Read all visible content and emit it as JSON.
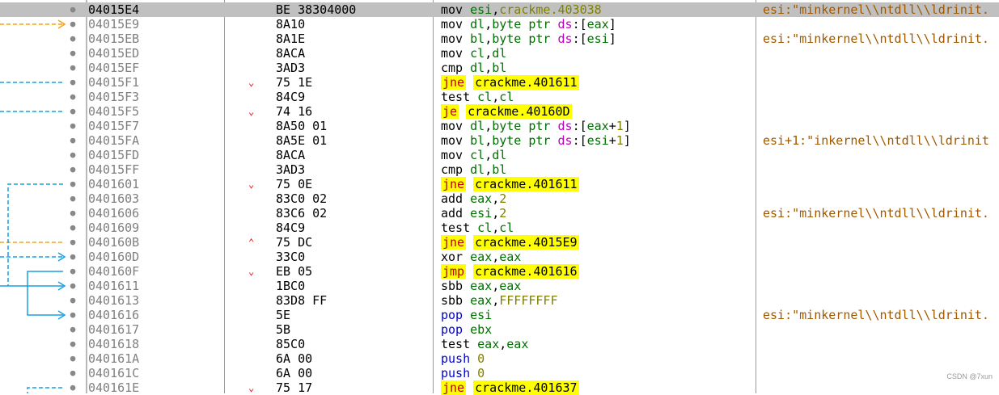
{
  "rows": [
    {
      "addr": "04015E4",
      "jmp": "",
      "bytes": "BE 38304000",
      "tokens": [
        {
          "t": "mov ",
          "c": "mn"
        },
        {
          "t": "esi",
          "c": "reg"
        },
        {
          "t": ",",
          "c": "mn"
        },
        {
          "t": "crackme.403038",
          "c": "num"
        }
      ],
      "comment": "esi:\"minkernel\\\\ntdll\\\\ldrinit.",
      "selected": true
    },
    {
      "addr": "04015E9",
      "jmp": "",
      "bytes": "8A10",
      "tokens": [
        {
          "t": "mov ",
          "c": "mn"
        },
        {
          "t": "dl",
          "c": "reg"
        },
        {
          "t": ",",
          "c": "mn"
        },
        {
          "t": "byte ptr ",
          "c": "op"
        },
        {
          "t": "ds",
          "c": "seg"
        },
        {
          "t": ":[",
          "c": "mn"
        },
        {
          "t": "eax",
          "c": "reg"
        },
        {
          "t": "]",
          "c": "mn"
        }
      ],
      "comment": ""
    },
    {
      "addr": "04015EB",
      "jmp": "",
      "bytes": "8A1E",
      "tokens": [
        {
          "t": "mov ",
          "c": "mn"
        },
        {
          "t": "bl",
          "c": "reg"
        },
        {
          "t": ",",
          "c": "mn"
        },
        {
          "t": "byte ptr ",
          "c": "op"
        },
        {
          "t": "ds",
          "c": "seg"
        },
        {
          "t": ":[",
          "c": "mn"
        },
        {
          "t": "esi",
          "c": "reg"
        },
        {
          "t": "]",
          "c": "mn"
        }
      ],
      "comment": "esi:\"minkernel\\\\ntdll\\\\ldrinit."
    },
    {
      "addr": "04015ED",
      "jmp": "",
      "bytes": "8ACA",
      "tokens": [
        {
          "t": "mov ",
          "c": "mn"
        },
        {
          "t": "cl",
          "c": "reg"
        },
        {
          "t": ",",
          "c": "mn"
        },
        {
          "t": "dl",
          "c": "reg"
        }
      ],
      "comment": ""
    },
    {
      "addr": "04015EF",
      "jmp": "",
      "bytes": "3AD3",
      "tokens": [
        {
          "t": "cmp ",
          "c": "mn"
        },
        {
          "t": "dl",
          "c": "reg"
        },
        {
          "t": ",",
          "c": "mn"
        },
        {
          "t": "bl",
          "c": "reg"
        }
      ],
      "comment": ""
    },
    {
      "addr": "04015F1",
      "jmp": "down",
      "bytes": "75 1E",
      "tokens": [
        {
          "t": "jne",
          "c": "jhl"
        },
        {
          "t": " ",
          "c": "mn"
        },
        {
          "t": "crackme.401611",
          "c": "thl"
        }
      ],
      "comment": ""
    },
    {
      "addr": "04015F3",
      "jmp": "",
      "bytes": "84C9",
      "tokens": [
        {
          "t": "test ",
          "c": "mn"
        },
        {
          "t": "cl",
          "c": "reg"
        },
        {
          "t": ",",
          "c": "mn"
        },
        {
          "t": "cl",
          "c": "reg"
        }
      ],
      "comment": ""
    },
    {
      "addr": "04015F5",
      "jmp": "down",
      "bytes": "74 16",
      "tokens": [
        {
          "t": "je",
          "c": "jhl"
        },
        {
          "t": " ",
          "c": "mn"
        },
        {
          "t": "crackme.40160D",
          "c": "thl"
        }
      ],
      "comment": ""
    },
    {
      "addr": "04015F7",
      "jmp": "",
      "bytes": "8A50 01",
      "tokens": [
        {
          "t": "mov ",
          "c": "mn"
        },
        {
          "t": "dl",
          "c": "reg"
        },
        {
          "t": ",",
          "c": "mn"
        },
        {
          "t": "byte ptr ",
          "c": "op"
        },
        {
          "t": "ds",
          "c": "seg"
        },
        {
          "t": ":[",
          "c": "mn"
        },
        {
          "t": "eax",
          "c": "reg"
        },
        {
          "t": "+",
          "c": "mn"
        },
        {
          "t": "1",
          "c": "num"
        },
        {
          "t": "]",
          "c": "mn"
        }
      ],
      "comment": ""
    },
    {
      "addr": "04015FA",
      "jmp": "",
      "bytes": "8A5E 01",
      "tokens": [
        {
          "t": "mov ",
          "c": "mn"
        },
        {
          "t": "bl",
          "c": "reg"
        },
        {
          "t": ",",
          "c": "mn"
        },
        {
          "t": "byte ptr ",
          "c": "op"
        },
        {
          "t": "ds",
          "c": "seg"
        },
        {
          "t": ":[",
          "c": "mn"
        },
        {
          "t": "esi",
          "c": "reg"
        },
        {
          "t": "+",
          "c": "mn"
        },
        {
          "t": "1",
          "c": "num"
        },
        {
          "t": "]",
          "c": "mn"
        }
      ],
      "comment": "esi+1:\"inkernel\\\\ntdll\\\\ldrinit"
    },
    {
      "addr": "04015FD",
      "jmp": "",
      "bytes": "8ACA",
      "tokens": [
        {
          "t": "mov ",
          "c": "mn"
        },
        {
          "t": "cl",
          "c": "reg"
        },
        {
          "t": ",",
          "c": "mn"
        },
        {
          "t": "dl",
          "c": "reg"
        }
      ],
      "comment": ""
    },
    {
      "addr": "04015FF",
      "jmp": "",
      "bytes": "3AD3",
      "tokens": [
        {
          "t": "cmp ",
          "c": "mn"
        },
        {
          "t": "dl",
          "c": "reg"
        },
        {
          "t": ",",
          "c": "mn"
        },
        {
          "t": "bl",
          "c": "reg"
        }
      ],
      "comment": ""
    },
    {
      "addr": "0401601",
      "jmp": "down",
      "bytes": "75 0E",
      "tokens": [
        {
          "t": "jne",
          "c": "jhl"
        },
        {
          "t": " ",
          "c": "mn"
        },
        {
          "t": "crackme.401611",
          "c": "thl"
        }
      ],
      "comment": ""
    },
    {
      "addr": "0401603",
      "jmp": "",
      "bytes": "83C0 02",
      "tokens": [
        {
          "t": "add ",
          "c": "mn"
        },
        {
          "t": "eax",
          "c": "reg"
        },
        {
          "t": ",",
          "c": "mn"
        },
        {
          "t": "2",
          "c": "num"
        }
      ],
      "comment": ""
    },
    {
      "addr": "0401606",
      "jmp": "",
      "bytes": "83C6 02",
      "tokens": [
        {
          "t": "add ",
          "c": "mn"
        },
        {
          "t": "esi",
          "c": "reg"
        },
        {
          "t": ",",
          "c": "mn"
        },
        {
          "t": "2",
          "c": "num"
        }
      ],
      "comment": "esi:\"minkernel\\\\ntdll\\\\ldrinit."
    },
    {
      "addr": "0401609",
      "jmp": "",
      "bytes": "84C9",
      "tokens": [
        {
          "t": "test ",
          "c": "mn"
        },
        {
          "t": "cl",
          "c": "reg"
        },
        {
          "t": ",",
          "c": "mn"
        },
        {
          "t": "cl",
          "c": "reg"
        }
      ],
      "comment": ""
    },
    {
      "addr": "040160B",
      "jmp": "up",
      "bytes": "75 DC",
      "tokens": [
        {
          "t": "jne",
          "c": "jhl"
        },
        {
          "t": " ",
          "c": "mn"
        },
        {
          "t": "crackme.4015E9",
          "c": "thl"
        }
      ],
      "comment": ""
    },
    {
      "addr": "040160D",
      "jmp": "",
      "bytes": "33C0",
      "tokens": [
        {
          "t": "xor ",
          "c": "mn"
        },
        {
          "t": "eax",
          "c": "reg"
        },
        {
          "t": ",",
          "c": "mn"
        },
        {
          "t": "eax",
          "c": "reg"
        }
      ],
      "comment": ""
    },
    {
      "addr": "040160F",
      "jmp": "down",
      "bytes": "EB 05",
      "tokens": [
        {
          "t": "jmp",
          "c": "jhl"
        },
        {
          "t": " ",
          "c": "mn"
        },
        {
          "t": "crackme.401616",
          "c": "thl"
        }
      ],
      "comment": ""
    },
    {
      "addr": "0401611",
      "jmp": "",
      "bytes": "1BC0",
      "tokens": [
        {
          "t": "sbb ",
          "c": "mn"
        },
        {
          "t": "eax",
          "c": "reg"
        },
        {
          "t": ",",
          "c": "mn"
        },
        {
          "t": "eax",
          "c": "reg"
        }
      ],
      "comment": ""
    },
    {
      "addr": "0401613",
      "jmp": "",
      "bytes": "83D8 FF",
      "tokens": [
        {
          "t": "sbb ",
          "c": "mn"
        },
        {
          "t": "eax",
          "c": "reg"
        },
        {
          "t": ",",
          "c": "mn"
        },
        {
          "t": "FFFFFFFF",
          "c": "num"
        }
      ],
      "comment": ""
    },
    {
      "addr": "0401616",
      "jmp": "",
      "bytes": "5E",
      "tokens": [
        {
          "t": "pop ",
          "c": "blue"
        },
        {
          "t": "esi",
          "c": "reg"
        }
      ],
      "comment": "esi:\"minkernel\\\\ntdll\\\\ldrinit."
    },
    {
      "addr": "0401617",
      "jmp": "",
      "bytes": "5B",
      "tokens": [
        {
          "t": "pop ",
          "c": "blue"
        },
        {
          "t": "ebx",
          "c": "reg"
        }
      ],
      "comment": ""
    },
    {
      "addr": "0401618",
      "jmp": "",
      "bytes": "85C0",
      "tokens": [
        {
          "t": "test ",
          "c": "mn"
        },
        {
          "t": "eax",
          "c": "reg"
        },
        {
          "t": ",",
          "c": "mn"
        },
        {
          "t": "eax",
          "c": "reg"
        }
      ],
      "comment": ""
    },
    {
      "addr": "040161A",
      "jmp": "",
      "bytes": "6A 00",
      "tokens": [
        {
          "t": "push ",
          "c": "blue"
        },
        {
          "t": "0",
          "c": "num"
        }
      ],
      "comment": ""
    },
    {
      "addr": "040161C",
      "jmp": "",
      "bytes": "6A 00",
      "tokens": [
        {
          "t": "push ",
          "c": "blue"
        },
        {
          "t": "0",
          "c": "num"
        }
      ],
      "comment": ""
    },
    {
      "addr": "040161E",
      "jmp": "down",
      "bytes": "75 17",
      "tokens": [
        {
          "t": "jne",
          "c": "jhl"
        },
        {
          "t": " ",
          "c": "mn"
        },
        {
          "t": "crackme.401637",
          "c": "thl"
        }
      ],
      "comment": ""
    }
  ],
  "jump_marks": {
    "down": "⌄",
    "up": "⌃"
  },
  "colors": {
    "arrow_orange": "#f0a020",
    "arrow_blue": "#1aa0e0",
    "jump_highlight": "#ffff00",
    "comment": "#a05800"
  },
  "watermark": "CSDN @7xun"
}
